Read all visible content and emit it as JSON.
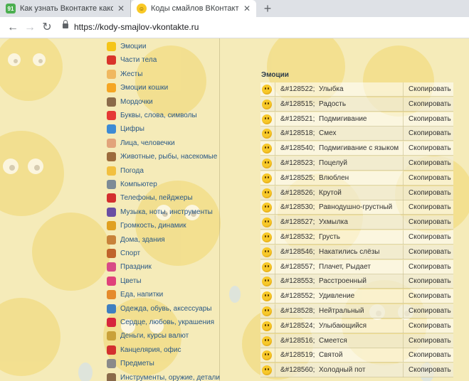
{
  "browser": {
    "tabs": [
      {
        "title": "Как узнать Вконтакте какой код",
        "favicon": "site-icon",
        "active": false
      },
      {
        "title": "Коды смайлов ВКонтакте | ☺ В",
        "favicon": "smiley-icon",
        "active": true
      }
    ],
    "new_tab": "+",
    "url": "https://kody-smajlov-vkontakte.ru"
  },
  "sidebar": {
    "categories": [
      {
        "label": "Эмоции",
        "icon": "smile-emoji",
        "color": "#f5c518"
      },
      {
        "label": "Части тела",
        "icon": "lips-emoji",
        "color": "#d9342b"
      },
      {
        "label": "Жесты",
        "icon": "thumbs-up-emoji",
        "color": "#f0b860"
      },
      {
        "label": "Эмоции кошки",
        "icon": "cat-face-emoji",
        "color": "#f5a623"
      },
      {
        "label": "Мордочки",
        "icon": "animal-face-emoji",
        "color": "#8b6b4a"
      },
      {
        "label": "Буквы, слова, символы",
        "icon": "letter-a-emoji",
        "color": "#e53935"
      },
      {
        "label": "Цифры",
        "icon": "number-one-emoji",
        "color": "#3d8bd4"
      },
      {
        "label": "Лица, человечки",
        "icon": "person-emoji",
        "color": "#e2a47a"
      },
      {
        "label": "Животные, рыбы, насекомые",
        "icon": "monkey-emoji",
        "color": "#9c6b3c"
      },
      {
        "label": "Погода",
        "icon": "weather-emoji",
        "color": "#f2c040"
      },
      {
        "label": "Компьютер",
        "icon": "computer-emoji",
        "color": "#7d8b96"
      },
      {
        "label": "Телефоны, пейджеры",
        "icon": "telephone-emoji",
        "color": "#d32f2f"
      },
      {
        "label": "Музыка, ноты, инструменты",
        "icon": "music-emoji",
        "color": "#6a4fa3"
      },
      {
        "label": "Громкость, динамик",
        "icon": "speaker-emoji",
        "color": "#e0a020"
      },
      {
        "label": "Дома, здания",
        "icon": "house-emoji",
        "color": "#c8823a"
      },
      {
        "label": "Спорт",
        "icon": "ball-emoji",
        "color": "#c0632b"
      },
      {
        "label": "Праздник",
        "icon": "gift-emoji",
        "color": "#d84a86"
      },
      {
        "label": "Цветы",
        "icon": "flower-emoji",
        "color": "#e0417a"
      },
      {
        "label": "Еда, напитки",
        "icon": "pizza-emoji",
        "color": "#e58a2a"
      },
      {
        "label": "Одежда, обувь, аксессуары",
        "icon": "clothing-emoji",
        "color": "#3f7fc0"
      },
      {
        "label": "Сердце, любовь, украшения",
        "icon": "heart-emoji",
        "color": "#d7263d"
      },
      {
        "label": "Деньги, курсы валют",
        "icon": "money-bag-emoji",
        "color": "#c9a13a"
      },
      {
        "label": "Канцелярия, офис",
        "icon": "pushpin-emoji",
        "color": "#d32f2f"
      },
      {
        "label": "Предметы",
        "icon": "key-emoji",
        "color": "#8a8a8a"
      },
      {
        "label": "Инструменты, оружие, детали",
        "icon": "hammer-emoji",
        "color": "#8a6a4a"
      }
    ]
  },
  "main": {
    "section_title": "Эмоции",
    "copy_label": "Скопировать",
    "rows": [
      {
        "code": "&#128522;",
        "name": "Улыбка"
      },
      {
        "code": "&#128515;",
        "name": "Радость"
      },
      {
        "code": "&#128521;",
        "name": "Подмигивание"
      },
      {
        "code": "&#128518;",
        "name": "Смех"
      },
      {
        "code": "&#128540;",
        "name": "Подмигивание с языком"
      },
      {
        "code": "&#128523;",
        "name": "Поцелуй"
      },
      {
        "code": "&#128525;",
        "name": "Влюблен"
      },
      {
        "code": "&#128526;",
        "name": "Крутой"
      },
      {
        "code": "&#128530;",
        "name": "Равнодушно-грустный"
      },
      {
        "code": "&#128527;",
        "name": "Ухмылка"
      },
      {
        "code": "&#128532;",
        "name": "Грусть"
      },
      {
        "code": "&#128546;",
        "name": "Накатились слёзы"
      },
      {
        "code": "&#128557;",
        "name": "Плачет, Рыдает"
      },
      {
        "code": "&#128553;",
        "name": "Расстроенный"
      },
      {
        "code": "&#128552;",
        "name": "Удивление"
      },
      {
        "code": "&#128528;",
        "name": "Нейтральный"
      },
      {
        "code": "&#128524;",
        "name": "Улыбающийся"
      },
      {
        "code": "&#128516;",
        "name": "Смеется"
      },
      {
        "code": "&#128519;",
        "name": "Святой"
      },
      {
        "code": "&#128560;",
        "name": "Холодный пот"
      }
    ]
  }
}
